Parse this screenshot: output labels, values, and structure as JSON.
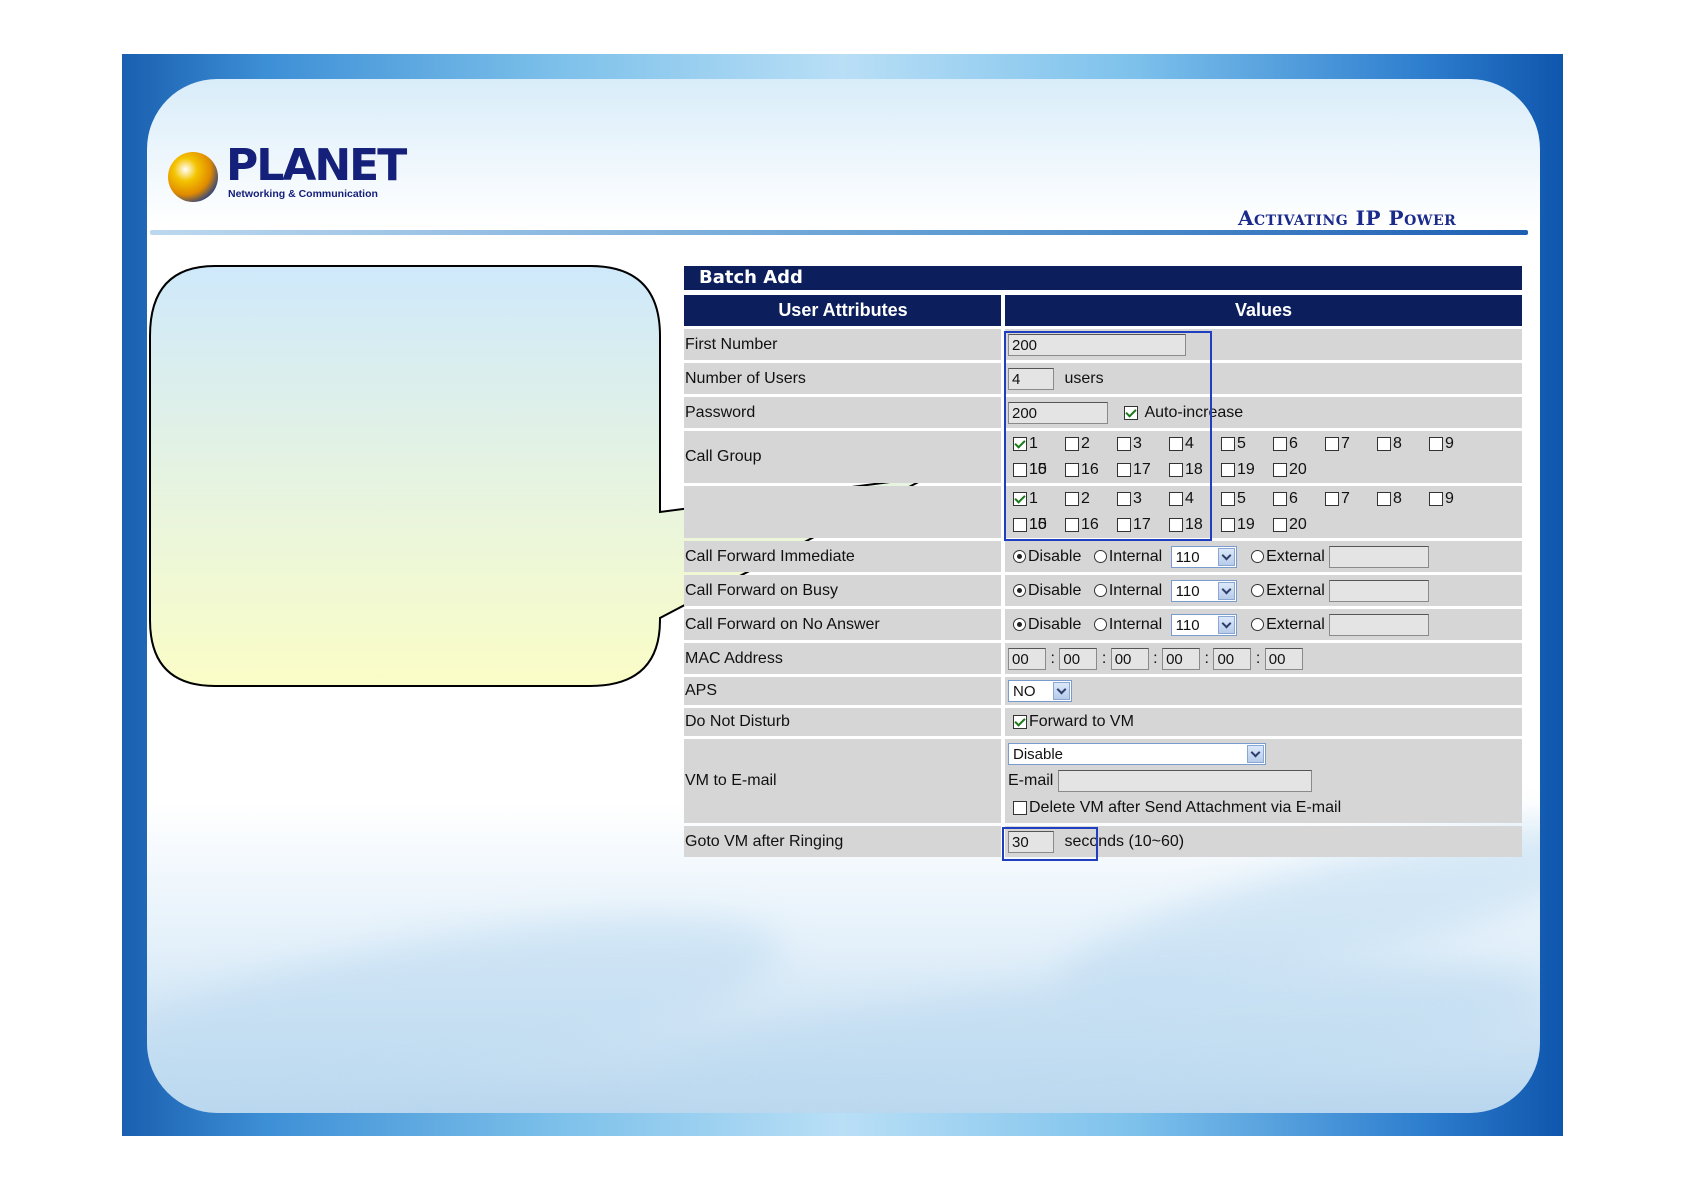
{
  "brand": {
    "logo_word": "PLANET",
    "logo_sub": "Networking & Communication",
    "tagline": "Activating IP Power"
  },
  "form": {
    "title": "Batch Add",
    "col_attr": "User Attributes",
    "col_values": "Values",
    "rows": {
      "first_number": {
        "label": "First Number",
        "value": "200"
      },
      "num_users": {
        "label": "Number of Users",
        "value": "4",
        "unit": "users"
      },
      "password": {
        "label": "Password",
        "value": "200",
        "auto_label": "Auto-increase",
        "auto_checked": true
      },
      "call_group": {
        "label": "Call Group"
      },
      "pickup_group": {
        "label": ""
      },
      "cf_immediate": {
        "label": "Call Forward Immediate",
        "option_disable": "Disable",
        "option_internal": "Internal",
        "internal_value": "110",
        "option_external": "External",
        "selected": "Disable"
      },
      "cf_busy": {
        "label": "Call Forward on Busy",
        "option_disable": "Disable",
        "option_internal": "Internal",
        "internal_value": "110",
        "option_external": "External",
        "selected": "Disable"
      },
      "cf_noanswer": {
        "label": "Call Forward on No Answer",
        "option_disable": "Disable",
        "option_internal": "Internal",
        "internal_value": "110",
        "option_external": "External",
        "selected": "Disable"
      },
      "mac": {
        "label": "MAC Address",
        "octets": [
          "00",
          "00",
          "00",
          "00",
          "00",
          "00"
        ],
        "sep": ":"
      },
      "aps": {
        "label": "APS",
        "value": "NO"
      },
      "dnd": {
        "label": "Do Not Disturb",
        "forward_label": "Forward to VM",
        "forward_checked": true
      },
      "vm_email": {
        "label": "VM to E-mail",
        "select_value": "Disable",
        "email_label": "E-mail",
        "email_value": "",
        "delete_label": "Delete VM after Send Attachment via E-mail",
        "delete_checked": false
      },
      "goto_vm": {
        "label": "Goto VM after Ringing",
        "value": "30",
        "unit": "seconds (10~60)"
      }
    },
    "groups_line1": [
      "1",
      "2",
      "3",
      "4",
      "5",
      "6",
      "7",
      "8",
      "9",
      "10"
    ],
    "groups_line2": [
      "15",
      "16",
      "17",
      "18",
      "19",
      "20"
    ],
    "call_group_checked": [
      "1"
    ],
    "pickup_group_checked": [
      "1"
    ]
  },
  "colors": {
    "header_bg": "#0c1f5c",
    "row_bg": "#d6d6d6",
    "highlight": "#1f3fc0",
    "callout_top": "#cfe9fb",
    "callout_bottom": "#fbfdc7"
  }
}
